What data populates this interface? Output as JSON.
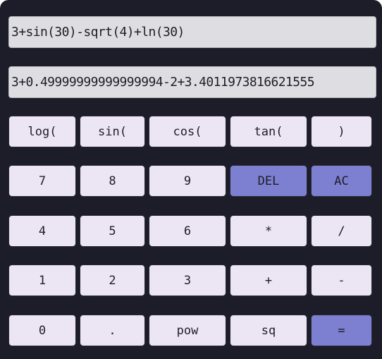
{
  "display": {
    "expression": "3+sin(30)-sqrt(4)+ln(30)",
    "result": "3+0.49999999999999994-2+3.4011973816621555"
  },
  "keys": {
    "log": "log(",
    "sin": "sin(",
    "cos": "cos(",
    "tan": "tan(",
    "close_paren": ")",
    "seven": "7",
    "eight": "8",
    "nine": "9",
    "del": "DEL",
    "ac": "AC",
    "four": "4",
    "five": "5",
    "six": "6",
    "multiply": "*",
    "divide": "/",
    "one": "1",
    "two": "2",
    "three": "3",
    "plus": "+",
    "minus": "-",
    "zero": "0",
    "dot": ".",
    "pow": "pow",
    "sq": "sq",
    "equals": "="
  },
  "colors": {
    "background": "#1c1d28",
    "key": "#ece5f3",
    "accent": "#7d80d0",
    "display": "#dedee2"
  }
}
